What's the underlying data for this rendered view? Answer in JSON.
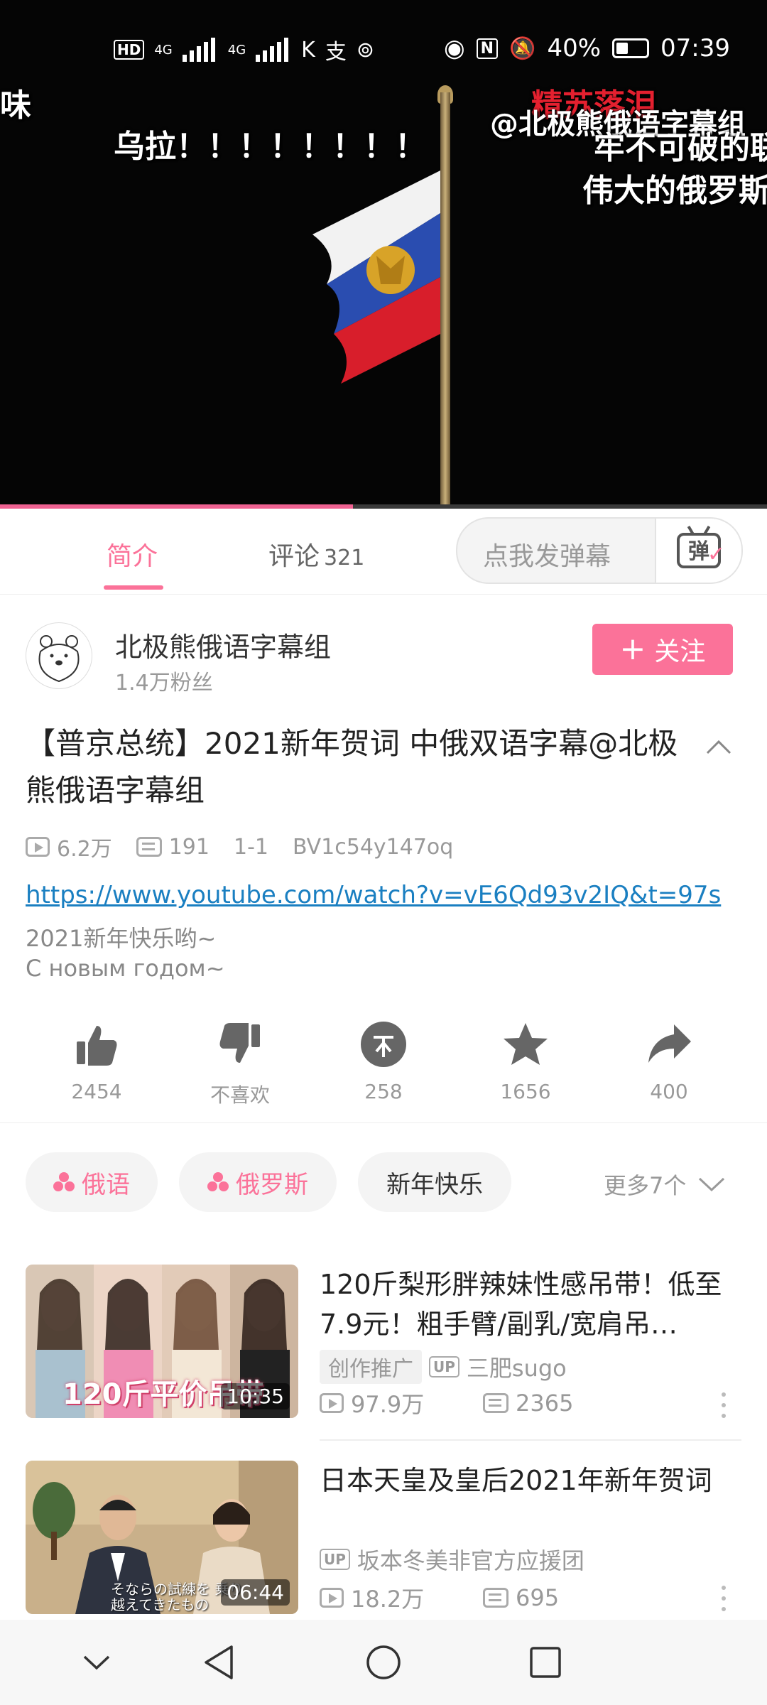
{
  "status_bar": {
    "left_indicators": [
      "HD",
      "4G",
      "4G",
      "K",
      "支"
    ],
    "battery": "40%",
    "time": "07:39"
  },
  "video": {
    "danmaku": [
      {
        "text": "味"
      },
      {
        "text": "乌拉！！！！！！！！"
      },
      {
        "text": "精苏落泪",
        "color": "#e4202f"
      },
      {
        "text": "@北极熊俄语字幕组"
      },
      {
        "text": "牢不可破的联"
      },
      {
        "text": "伟大的俄罗斯"
      }
    ],
    "progress_fraction": 0.46
  },
  "tabs": {
    "intro_label": "简介",
    "comments_label": "评论",
    "comments_count": "321",
    "danmu_placeholder": "点我发弹幕",
    "danmu_button": "弹"
  },
  "uploader": {
    "name": "北极熊俄语字幕组",
    "fans": "1.4万粉丝",
    "follow_label": "关注"
  },
  "video_info": {
    "title": "【普京总统】2021新年贺词 中俄双语字幕@北极熊俄语字幕组",
    "views": "6.2万",
    "danmaku_count": "191",
    "part": "1-1",
    "bvid": "BV1c54y147oq",
    "link": "https://www.youtube.com/watch?v=vE6Qd93v2IQ&t=97s",
    "desc_line1": "2021新年快乐哟~",
    "desc_line2": "С новым годом~"
  },
  "actions": {
    "like": "2454",
    "dislike": "不喜欢",
    "coin": "258",
    "favorite": "1656",
    "share": "400"
  },
  "tags": {
    "items": [
      "俄语",
      "俄罗斯",
      "新年快乐"
    ],
    "more": "更多7个"
  },
  "recommendations": [
    {
      "title": "120斤梨形胖辣妹性感吊带！低至7.9元！粗手臂/副乳/宽肩吊…",
      "thumb_caption": "120斤平价吊带",
      "duration": "10:35",
      "badge": "创作推广",
      "up_label": "UP",
      "author": "三肥sugo",
      "views": "97.9万",
      "danmaku": "2365"
    },
    {
      "title": "日本天皇及皇后2021年新年贺词",
      "thumb_caption": "そならの試練を 乗り越えてきたもの",
      "duration": "06:44",
      "up_label": "UP",
      "author": "坂本冬美非官方应援团",
      "views": "18.2万",
      "danmaku": "695"
    }
  ],
  "colors": {
    "accent": "#fb7299",
    "link": "#1a7fc1",
    "video_bg": "#050505"
  }
}
